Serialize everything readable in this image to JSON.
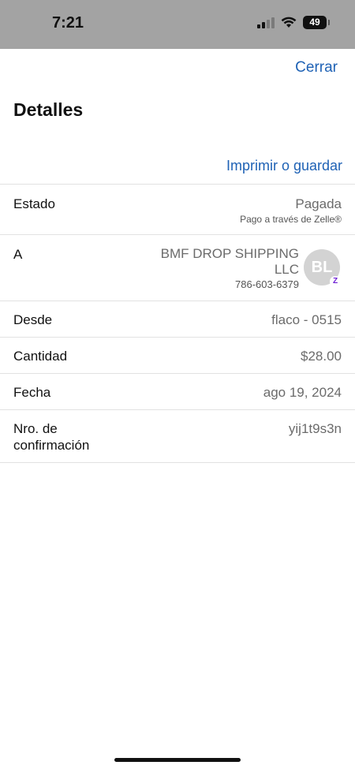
{
  "status_bar": {
    "time": "7:21",
    "battery_level": "49"
  },
  "header": {
    "close_label": "Cerrar",
    "title": "Detalles",
    "print_label": "Imprimir o guardar"
  },
  "details": {
    "estado": {
      "label": "Estado",
      "value": "Pagada",
      "sub": "Pago a través de Zelle®"
    },
    "a": {
      "label": "A",
      "name": "BMF DROP SHIPPING LLC",
      "phone": "786-603-6379",
      "initials": "BL",
      "badge": "Z"
    },
    "desde": {
      "label": "Desde",
      "value": "flaco - 0515"
    },
    "cantidad": {
      "label": "Cantidad",
      "value": "$28.00"
    },
    "fecha": {
      "label": "Fecha",
      "value": "ago 19, 2024"
    },
    "confirmacion": {
      "label": "Nro. de confirmación",
      "value": "yij1t9s3n"
    }
  },
  "colors": {
    "link": "#1f62b5",
    "status_bar": "#a3a3a3",
    "zelle": "#6d1ed4"
  }
}
